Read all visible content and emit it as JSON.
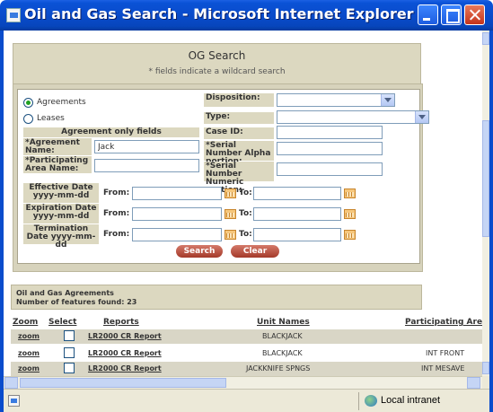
{
  "window": {
    "title": "Oil and Gas Search - Microsoft Internet Explorer"
  },
  "header": {
    "title": "OG Search",
    "subtitle": "* fields indicate a wildcard search"
  },
  "form": {
    "radio_agreements": "Agreements",
    "radio_leases": "Leases",
    "selected_radio": "Agreements",
    "agreement_only_fields": "Agreement only fields",
    "agreement_name_label": "*Agreement Name:",
    "agreement_name_value": "Jack",
    "participating_area_label": "*Participating Area Name:",
    "participating_area_value": "",
    "disposition_label": "Disposition:",
    "disposition_value": "",
    "type_label": "Type:",
    "type_value": "",
    "case_id_label": "Case ID:",
    "case_id_value": "",
    "serial_alpha_label": "*Serial Number Alpha portion:",
    "serial_alpha_value": "",
    "serial_numeric_label": "*Serial Number Numeric portion:",
    "serial_numeric_value": "",
    "from_label": "From:",
    "to_label": "To:",
    "dates": [
      {
        "label": "Effective Date yyyy-mm-dd",
        "from": "",
        "to": ""
      },
      {
        "label": "Expiration Date yyyy-mm-dd",
        "from": "",
        "to": ""
      },
      {
        "label": "Termination Date yyyy-mm-dd",
        "from": "",
        "to": ""
      }
    ],
    "search_button": "Search",
    "clear_button": "Clear"
  },
  "results": {
    "heading": "Oil and Gas Agreements",
    "count_text": "Number of features found: 23",
    "columns": {
      "zoom": "Zoom",
      "select": "Select",
      "reports": "Reports",
      "unit_names": "Unit Names",
      "participating_area": "Participating Are"
    },
    "rows": [
      {
        "zoom": "zoom",
        "report": "LR2000 CR Report",
        "unit_name": "BLACKJACK",
        "participating_area": ""
      },
      {
        "zoom": "zoom",
        "report": "LR2000 CR Report",
        "unit_name": "BLACKJACK",
        "participating_area": "INT FRONT"
      },
      {
        "zoom": "zoom",
        "report": "LR2000 CR Report",
        "unit_name": "JACKKNIFE SPNGS",
        "participating_area": "INT MESAVE"
      }
    ]
  },
  "status": {
    "zone": "Local intranet"
  }
}
